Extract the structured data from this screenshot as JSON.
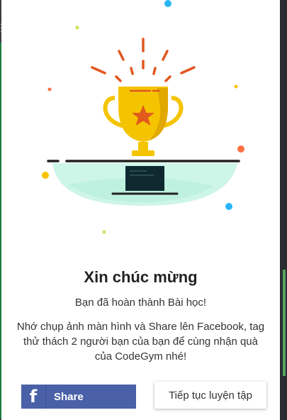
{
  "background": {
    "left_glyph": "☰"
  },
  "modal": {
    "title": "Xin chúc mừng",
    "subtitle": "Bạn đã hoàn thành Bài học!",
    "description": "Nhớ chụp ảnh màn hình và Share lên Facebook, tag thử thách 2 người bạn của bạn để cùng nhận quà của CodeGym nhé!",
    "share_button": {
      "label": "Share",
      "icon": "facebook-icon",
      "color": "#4a61a8"
    },
    "continue_button": {
      "label": "Tiếp tục luyện tập"
    }
  },
  "illustration": {
    "icon": "trophy-icon",
    "trophy_color": "#f5c400",
    "star_color": "#e25a1c",
    "bowl_color": "#cdf5e8"
  }
}
